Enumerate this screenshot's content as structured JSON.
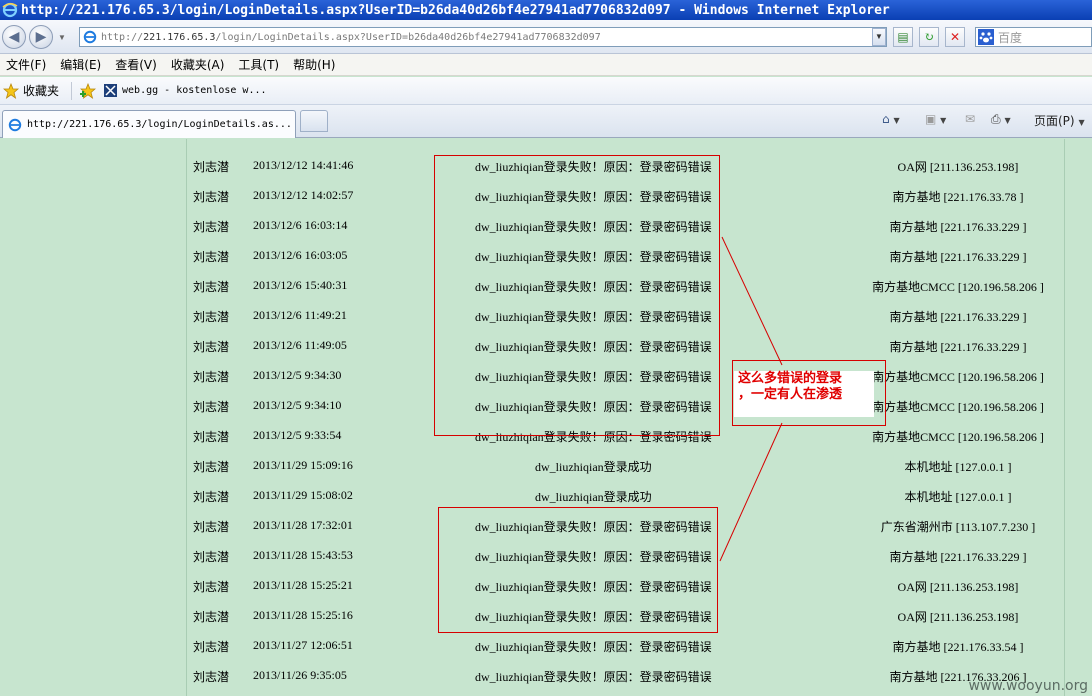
{
  "window": {
    "title": "http://221.176.65.3/login/LoginDetails.aspx?UserID=b26da40d26bf4e27941ad7706832d097 - Windows Internet Explorer"
  },
  "address_bar": {
    "prefix": "http://",
    "host": "221.176.65.3",
    "path": "/login/LoginDetails.aspx?UserID=b26da40d26bf4e27941ad7706832d097"
  },
  "search": {
    "placeholder": "百度"
  },
  "menu": [
    "文件(F)",
    "编辑(E)",
    "查看(V)",
    "收藏夹(A)",
    "工具(T)",
    "帮助(H)"
  ],
  "favorites": {
    "label": "收藏夹",
    "link": "web.gg - kostenlose w..."
  },
  "tab": {
    "title": "http://221.176.65.3/login/LoginDetails.as..."
  },
  "commands": {
    "page": "页面(P)"
  },
  "log_rows": [
    {
      "name": "刘志潜",
      "time": "2013/12/12 14:41:46",
      "message": "dw_liuzhiqian登录失败！原因：登录密码错误",
      "location": "OA网 [211.136.253.198]"
    },
    {
      "name": "刘志潜",
      "time": "2013/12/12 14:02:57",
      "message": "dw_liuzhiqian登录失败！原因：登录密码错误",
      "location": "南方基地 [221.176.33.78 ]"
    },
    {
      "name": "刘志潜",
      "time": "2013/12/6 16:03:14",
      "message": "dw_liuzhiqian登录失败！原因：登录密码错误",
      "location": "南方基地 [221.176.33.229 ]"
    },
    {
      "name": "刘志潜",
      "time": "2013/12/6 16:03:05",
      "message": "dw_liuzhiqian登录失败！原因：登录密码错误",
      "location": "南方基地 [221.176.33.229 ]"
    },
    {
      "name": "刘志潜",
      "time": "2013/12/6 15:40:31",
      "message": "dw_liuzhiqian登录失败！原因：登录密码错误",
      "location": "南方基地CMCC [120.196.58.206 ]"
    },
    {
      "name": "刘志潜",
      "time": "2013/12/6 11:49:21",
      "message": "dw_liuzhiqian登录失败！原因：登录密码错误",
      "location": "南方基地 [221.176.33.229 ]"
    },
    {
      "name": "刘志潜",
      "time": "2013/12/6 11:49:05",
      "message": "dw_liuzhiqian登录失败！原因：登录密码错误",
      "location": "南方基地 [221.176.33.229 ]"
    },
    {
      "name": "刘志潜",
      "time": "2013/12/5 9:34:30",
      "message": "dw_liuzhiqian登录失败！原因：登录密码错误",
      "location": "南方基地CMCC [120.196.58.206 ]"
    },
    {
      "name": "刘志潜",
      "time": "2013/12/5 9:34:10",
      "message": "dw_liuzhiqian登录失败！原因：登录密码错误",
      "location": "南方基地CMCC [120.196.58.206 ]"
    },
    {
      "name": "刘志潜",
      "time": "2013/12/5 9:33:54",
      "message": "dw_liuzhiqian登录失败！原因：登录密码错误",
      "location": "南方基地CMCC [120.196.58.206 ]"
    },
    {
      "name": "刘志潜",
      "time": "2013/11/29 15:09:16",
      "message": "dw_liuzhiqian登录成功",
      "location": "本机地址 [127.0.0.1 ]"
    },
    {
      "name": "刘志潜",
      "time": "2013/11/29 15:08:02",
      "message": "dw_liuzhiqian登录成功",
      "location": "本机地址 [127.0.0.1 ]"
    },
    {
      "name": "刘志潜",
      "time": "2013/11/28 17:32:01",
      "message": "dw_liuzhiqian登录失败！原因：登录密码错误",
      "location": "广东省潮州市 [113.107.7.230 ]"
    },
    {
      "name": "刘志潜",
      "time": "2013/11/28 15:43:53",
      "message": "dw_liuzhiqian登录失败！原因：登录密码错误",
      "location": "南方基地 [221.176.33.229 ]"
    },
    {
      "name": "刘志潜",
      "time": "2013/11/28 15:25:21",
      "message": "dw_liuzhiqian登录失败！原因：登录密码错误",
      "location": "OA网 [211.136.253.198]"
    },
    {
      "name": "刘志潜",
      "time": "2013/11/28 15:25:16",
      "message": "dw_liuzhiqian登录失败！原因：登录密码错误",
      "location": "OA网 [211.136.253.198]"
    },
    {
      "name": "刘志潜",
      "time": "2013/11/27 12:06:51",
      "message": "dw_liuzhiqian登录失败！原因：登录密码错误",
      "location": "南方基地 [221.176.33.54 ]"
    },
    {
      "name": "刘志潜",
      "time": "2013/11/26 9:35:05",
      "message": "dw_liuzhiqian登录失败！原因：登录密码错误",
      "location": "南方基地 [221.176.33.206 ]"
    }
  ],
  "annotation": {
    "line1": "这么多错误的登录",
    "line2": "，一定有人在渗透"
  },
  "watermark": "www.wooyun.org",
  "colors": {
    "content_bg": "#c7e5cf",
    "annotation_red": "#d60000",
    "titlebar_blue": "#0a3fb3"
  }
}
